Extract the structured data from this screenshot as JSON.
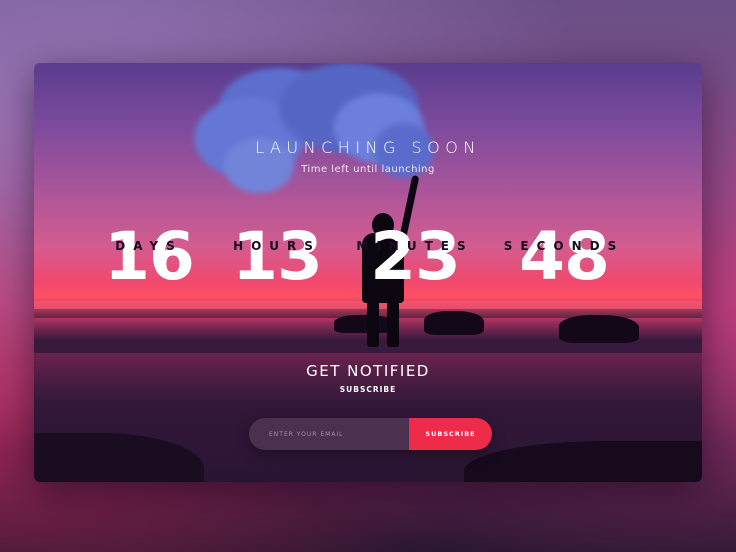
{
  "hero": {
    "title": "LAUNCHING SOON",
    "subtitle": "Time left until launching"
  },
  "countdown": [
    {
      "value": "16",
      "label": "DAYS"
    },
    {
      "value": "13",
      "label": "HOURS"
    },
    {
      "value": "23",
      "label": "MINUTES"
    },
    {
      "value": "48",
      "label": "SECONDS"
    }
  ],
  "notify": {
    "heading": "GET NOTIFIED",
    "subheading": "SUBSCRIBE",
    "email_placeholder": "ENTER YOUR EMAIL",
    "button_label": "SUBSCRIBE"
  },
  "colors": {
    "accent": "#ee2b49",
    "input_bg": "#4b3050",
    "smoke": "#5d6fce"
  }
}
